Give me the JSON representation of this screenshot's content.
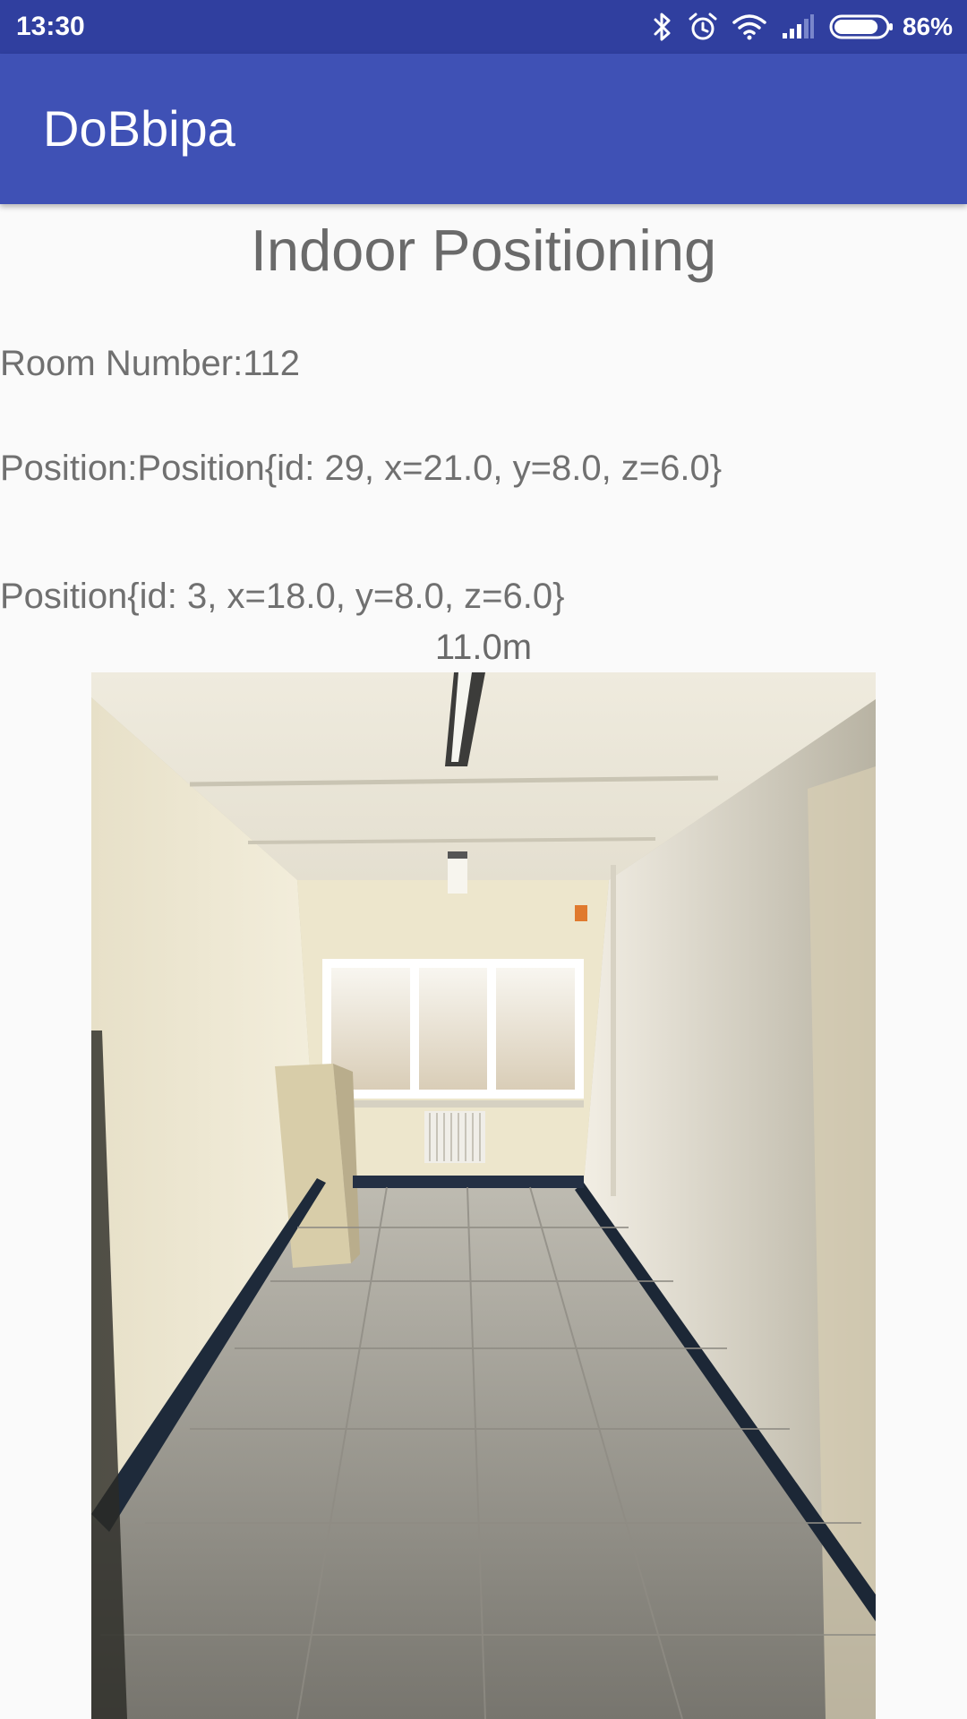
{
  "status_bar": {
    "time": "13:30",
    "battery_percent": "86%",
    "battery_level": 0.86,
    "icons": [
      "bluetooth-icon",
      "alarm-icon",
      "wifi-icon",
      "signal-icon",
      "battery-icon"
    ]
  },
  "app_bar": {
    "title": "DoBbipa",
    "color": "#3f51b5"
  },
  "main": {
    "heading": "Indoor Positioning",
    "room_number": "Room Number:112",
    "position": "Position:Position{id: 29, x=21.0, y=8.0, z=6.0}",
    "nearest_position": "Position{id: 3, x=18.0, y=8.0, z=6.0}",
    "distance": "11.0m"
  },
  "image": {
    "subject": "corridor-photo"
  }
}
